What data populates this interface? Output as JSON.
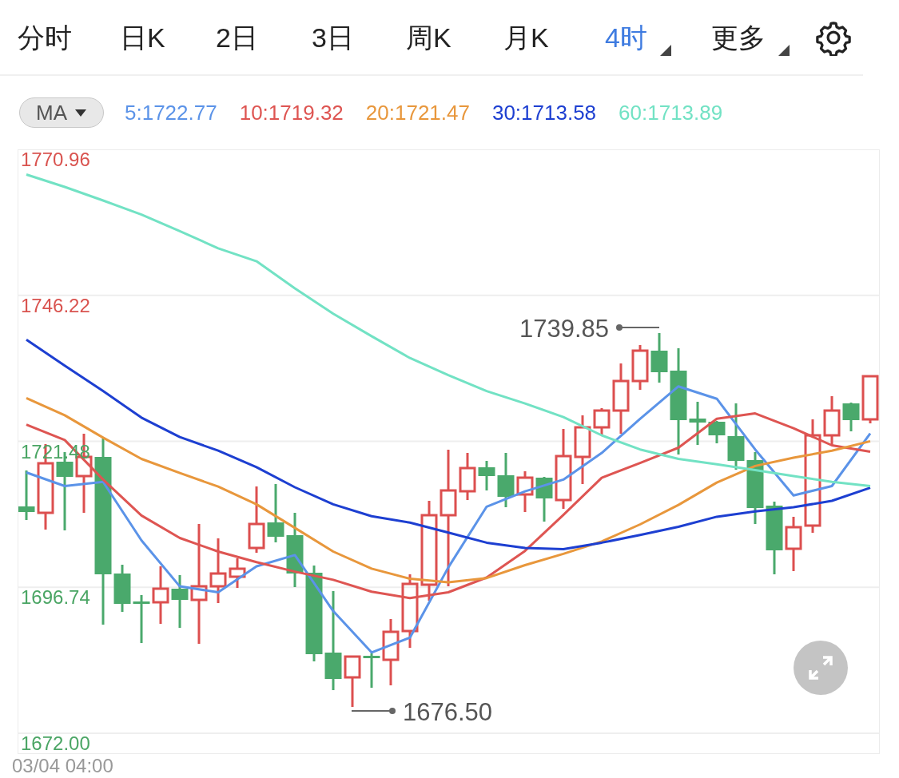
{
  "tabs": [
    {
      "label": "分时",
      "selected": false,
      "dropdown": false
    },
    {
      "label": "日K",
      "selected": false,
      "dropdown": false
    },
    {
      "label": "2日",
      "selected": false,
      "dropdown": false
    },
    {
      "label": "3日",
      "selected": false,
      "dropdown": false
    },
    {
      "label": "周K",
      "selected": false,
      "dropdown": false
    },
    {
      "label": "月K",
      "selected": false,
      "dropdown": false
    },
    {
      "label": "4时",
      "selected": true,
      "dropdown": true
    },
    {
      "label": "更多",
      "selected": false,
      "dropdown": true
    }
  ],
  "indicator": {
    "label": "MA"
  },
  "ma_values": [
    {
      "text": "5:1722.77",
      "color": "#5b93e8"
    },
    {
      "text": "10:1719.32",
      "color": "#de5552"
    },
    {
      "text": "20:1721.47",
      "color": "#e8973c"
    },
    {
      "text": "30:1713.58",
      "color": "#1d3fd1"
    },
    {
      "text": "60:1713.89",
      "color": "#72e2c4"
    }
  ],
  "chart": {
    "y_labels": [
      {
        "color": "#d9534f"
      },
      {
        "color": "#d9534f"
      },
      {
        "color": "#4aa564"
      },
      {
        "color": "#4aa564"
      },
      {
        "color": "#4aa564"
      }
    ],
    "high_marker": "1739.85",
    "low_marker": "1676.50",
    "chart_data": {
      "type": "line",
      "grid": true,
      "categories": [
        null,
        null,
        null,
        null,
        null,
        null,
        null,
        null,
        null,
        null,
        null,
        null,
        null,
        null,
        null,
        null,
        null,
        null,
        null,
        null,
        null,
        null,
        null
      ],
      "ylim": [
        1672.0,
        1770.96
      ],
      "yticks": [
        {
          "value": 1770.96,
          "label": "1770.96"
        },
        {
          "value": 1746.22,
          "label": "1746.22"
        },
        {
          "value": 1721.48,
          "label": "1721.48"
        },
        {
          "value": 1696.74,
          "label": "1696.74"
        },
        {
          "value": 1672.0,
          "label": "1672.00"
        }
      ],
      "series": [
        {
          "color": "#5b93e8",
          "values": [
            1716.2,
            1713.9,
            1714.6,
            1704.7,
            1696.9,
            1695.9,
            1700.3,
            1702.2,
            1692.7,
            1685.7,
            1688.2,
            1700.1,
            1710.4,
            1713.0,
            1715.0,
            1719.5,
            1725.3,
            1730.8,
            1728.7,
            1720.1,
            1712.3,
            1713.9,
            1722.8
          ]
        },
        {
          "color": "#de5552",
          "values": [
            1724.3,
            1721.7,
            1715.0,
            1708.9,
            1705.1,
            1702.8,
            1701.0,
            1699.4,
            1698.0,
            1696.0,
            1694.9,
            1695.9,
            1698.4,
            1702.9,
            1709.0,
            1715.3,
            1717.8,
            1720.4,
            1725.3,
            1726.2,
            1723.7,
            1720.8,
            1719.7
          ]
        },
        {
          "color": "#e8973c",
          "values": [
            1728.8,
            1725.9,
            1722.1,
            1718.5,
            1716.1,
            1713.8,
            1710.8,
            1706.8,
            1702.8,
            1699.9,
            1698.2,
            1697.6,
            1698.3,
            1700.5,
            1702.4,
            1704.5,
            1707.4,
            1710.7,
            1714.5,
            1717.3,
            1718.7,
            1719.9,
            1721.5
          ]
        },
        {
          "color": "#1d3fd1",
          "values": [
            1738.7,
            1734.3,
            1730.0,
            1725.5,
            1722.2,
            1719.9,
            1717.1,
            1713.7,
            1710.8,
            1708.8,
            1707.7,
            1706.0,
            1704.3,
            1703.4,
            1703.2,
            1704.3,
            1705.6,
            1707.0,
            1708.7,
            1709.6,
            1710.3,
            1711.4,
            1713.6
          ]
        },
        {
          "color": "#72e2c4",
          "values": [
            1766.7,
            1764.6,
            1762.3,
            1759.9,
            1757.1,
            1754.2,
            1752.0,
            1747.4,
            1743.1,
            1739.3,
            1735.6,
            1732.7,
            1730.0,
            1727.9,
            1725.6,
            1722.5,
            1720.1,
            1718.5,
            1717.6,
            1716.6,
            1715.6,
            1714.6,
            1713.9
          ]
        }
      ]
    }
  },
  "footer": {
    "time": "03/04 04:00"
  }
}
